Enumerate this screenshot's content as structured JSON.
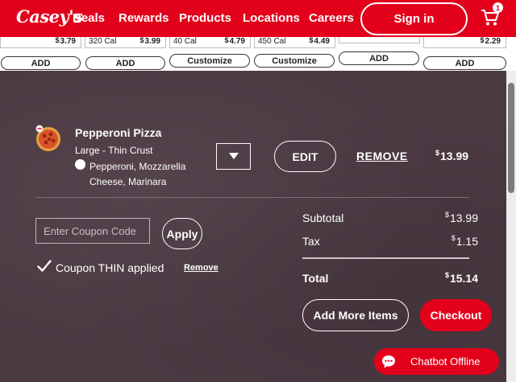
{
  "header": {
    "logo": "Casey's",
    "nav": [
      "Deals",
      "Rewards",
      "Products",
      "Locations",
      "Careers"
    ],
    "sign_in": "Sign in",
    "cart_count": "1"
  },
  "strip": {
    "cards": [
      {
        "cal": "",
        "price_dollar": "$",
        "price": "3.79"
      },
      {
        "cal": "320 Cal",
        "price_dollar": "$",
        "price": "3.99"
      },
      {
        "cal": "40 Cal",
        "price_dollar": "$",
        "price": "4.79"
      },
      {
        "cal": "450 Cal",
        "price_dollar": "$",
        "price": "4.49"
      },
      {
        "cal": "",
        "price_dollar": "",
        "price": ""
      },
      {
        "cal": "",
        "price_dollar": "$",
        "price": "2.29"
      }
    ],
    "buttons": [
      "ADD",
      "ADD",
      "Customize",
      "Customize",
      "ADD",
      "ADD"
    ]
  },
  "cart_item": {
    "name": "Pepperoni Pizza",
    "size": "Large - Thin Crust",
    "toppings": "Pepperoni, Mozzarella Cheese, Marinara",
    "edit": "EDIT",
    "remove": "REMOVE",
    "price_dollar": "$",
    "price": "13.99"
  },
  "coupon": {
    "placeholder": "Enter Coupon Code",
    "apply": "Apply",
    "status": "Coupon THIN applied",
    "remove": "Remove"
  },
  "summary": {
    "subtotal_label": "Subtotal",
    "subtotal_value": "13.99",
    "tax_label": "Tax",
    "tax_value": "1.15",
    "total_label": "Total",
    "total_value": "15.14",
    "currency": "$"
  },
  "actions": {
    "add_more": "Add More Items",
    "checkout": "Checkout"
  },
  "chatbot": {
    "label": "Chatbot Offline"
  },
  "colors": {
    "brand_red": "#e3001b",
    "panel_bg": "#4c3a43"
  }
}
